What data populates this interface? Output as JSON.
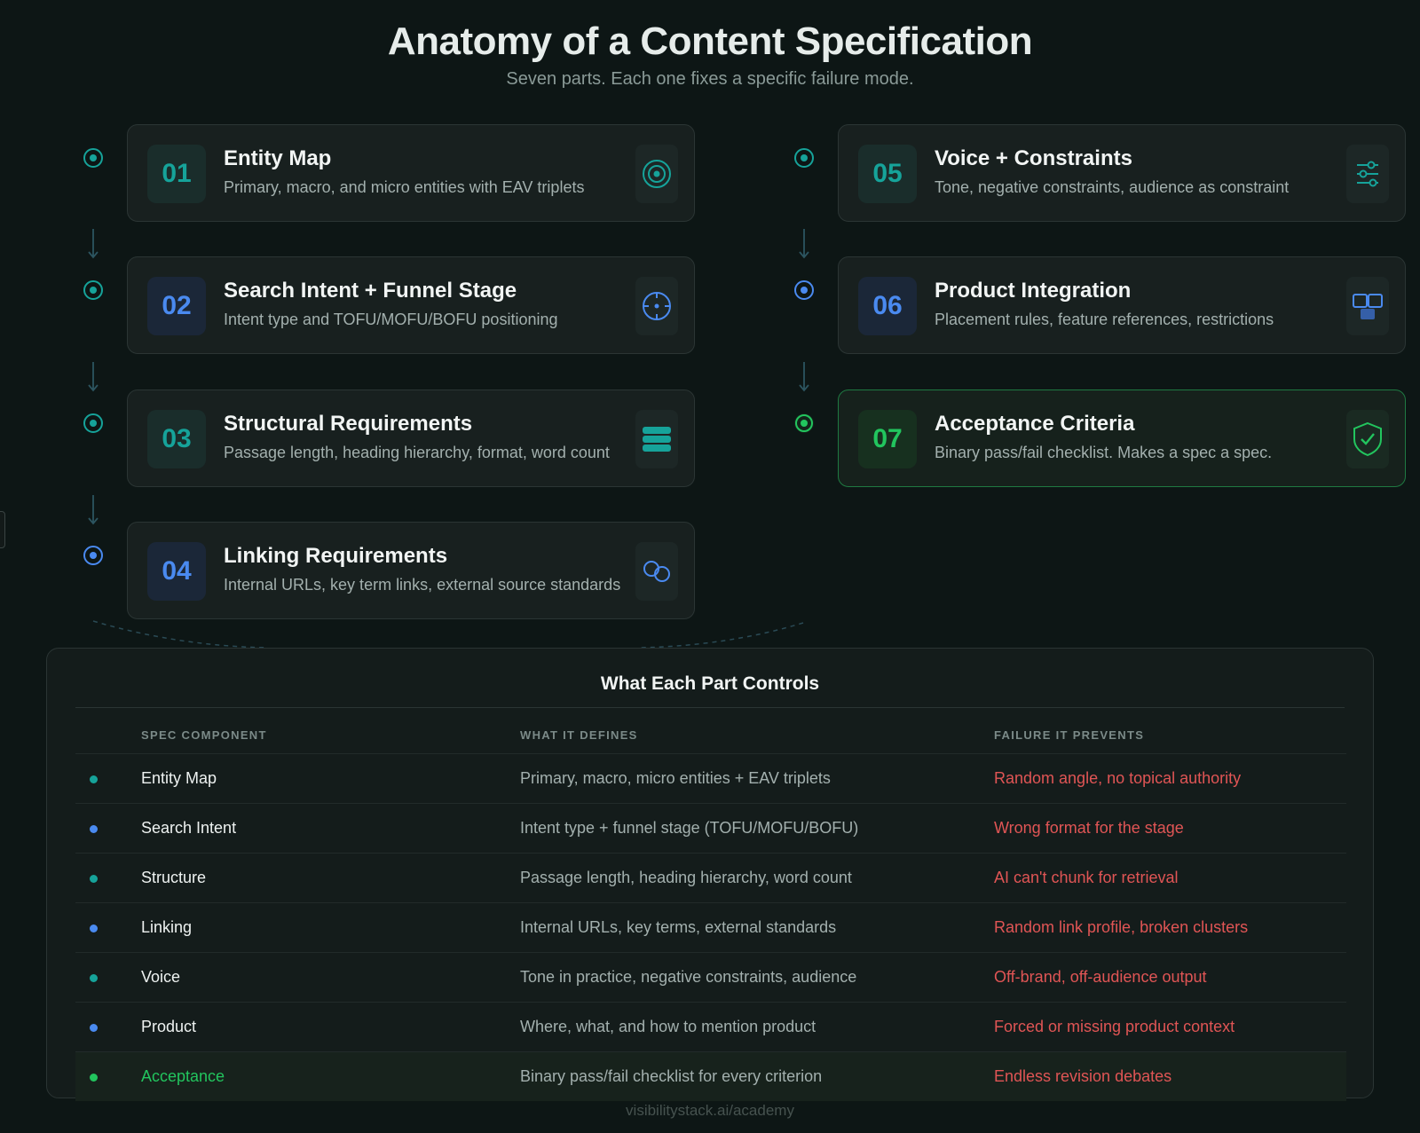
{
  "header": {
    "title": "Anatomy of a Content Specification",
    "subtitle": "Seven parts. Each one fixes a specific failure mode."
  },
  "cards": [
    {
      "num": "01",
      "title": "Entity Map",
      "desc": "Primary, macro, and micro entities with EAV triplets",
      "icon": "target-icon",
      "color": "#16a39a"
    },
    {
      "num": "02",
      "title": "Search Intent + Funnel Stage",
      "desc": "Intent type and TOFU/MOFU/BOFU positioning",
      "icon": "crosshair-icon",
      "color": "#4a8af0"
    },
    {
      "num": "03",
      "title": "Structural Requirements",
      "desc": "Passage length, heading hierarchy, format, word count",
      "icon": "stack-icon",
      "color": "#16a39a"
    },
    {
      "num": "04",
      "title": "Linking Requirements",
      "desc": "Internal URLs, key term links, external source standards",
      "icon": "link-icon",
      "color": "#4a8af0"
    },
    {
      "num": "05",
      "title": "Voice + Constraints",
      "desc": "Tone, negative constraints, audience as constraint",
      "icon": "sliders-icon",
      "color": "#16a39a"
    },
    {
      "num": "06",
      "title": "Product Integration",
      "desc": "Placement rules, feature references, restrictions",
      "icon": "layout-icon",
      "color": "#4a8af0"
    },
    {
      "num": "07",
      "title": "Acceptance Criteria",
      "desc": "Binary pass/fail checklist. Makes a spec a spec.",
      "icon": "shield-check-icon",
      "color": "#22c55e"
    }
  ],
  "table": {
    "title": "What Each Part Controls",
    "headers": [
      "SPEC COMPONENT",
      "WHAT IT DEFINES",
      "FAILURE IT PREVENTS"
    ],
    "rows": [
      {
        "component": "Entity Map",
        "defines": "Primary, macro, micro entities + EAV triplets",
        "prevents": "Random angle, no topical authority",
        "dot": "#16a39a"
      },
      {
        "component": "Search Intent",
        "defines": "Intent type + funnel stage (TOFU/MOFU/BOFU)",
        "prevents": "Wrong format for the stage",
        "dot": "#4a8af0"
      },
      {
        "component": "Structure",
        "defines": "Passage length, heading hierarchy, word count",
        "prevents": "AI can't chunk for retrieval",
        "dot": "#16a39a"
      },
      {
        "component": "Linking",
        "defines": "Internal URLs, key terms, external standards",
        "prevents": "Random link profile, broken clusters",
        "dot": "#4a8af0"
      },
      {
        "component": "Voice",
        "defines": "Tone in practice, negative constraints, audience",
        "prevents": "Off-brand, off-audience output",
        "dot": "#16a39a"
      },
      {
        "component": "Product",
        "defines": "Where, what, and how to mention product",
        "prevents": "Forced or missing product context",
        "dot": "#4a8af0"
      },
      {
        "component": "Acceptance",
        "defines": "Binary pass/fail checklist for every criterion",
        "prevents": "Endless revision debates",
        "dot": "#22c55e"
      }
    ]
  },
  "footer": "visibilitystack.ai/academy",
  "colors": {
    "teal": "#16a39a",
    "blue": "#4a8af0",
    "green": "#22c55e",
    "red": "#e05555",
    "background": "#0d1615"
  }
}
